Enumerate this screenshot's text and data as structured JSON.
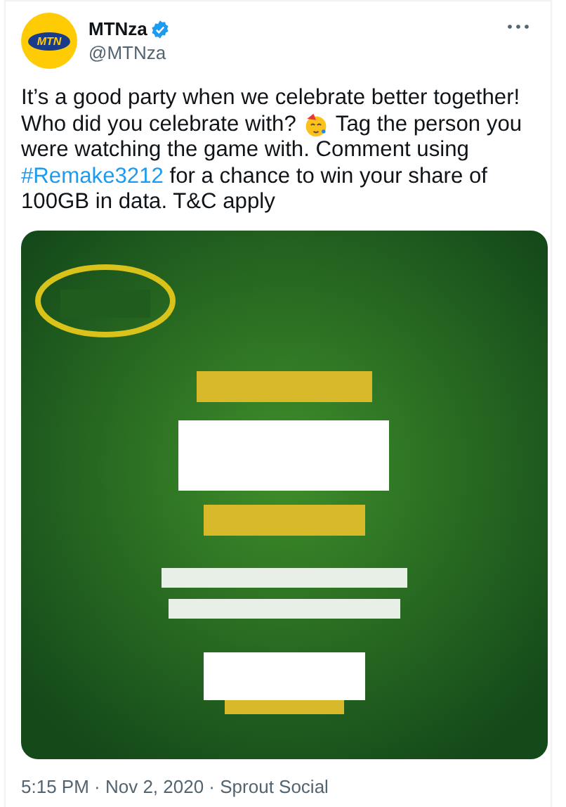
{
  "author": {
    "logo_text": "MTN",
    "name": "MTNza",
    "verified": true,
    "handle": "@MTNza"
  },
  "tweet": {
    "line_1": "It’s a good party when we celebrate better together!",
    "line_2_start": "Who did you celebrate with?",
    "line_2_end": "Tag the person you",
    "rest_start": "were watching the game with. Comment using",
    "hashtag": "#Remake3212",
    "rest_end": "for a chance to win your share of 100GB in data. T&C apply"
  },
  "meta": {
    "timestamp": "5:15 PM · Nov 2, 2020 · Sprout Social"
  }
}
